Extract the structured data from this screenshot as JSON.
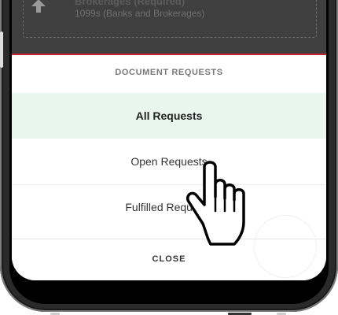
{
  "background_card": {
    "title": "Brokerages (Required)",
    "subtitle": "1099s (Banks and Brokerages)",
    "icon": "upload-icon"
  },
  "sheet": {
    "header": "DOCUMENT REQUESTS",
    "options": [
      {
        "label": "All Requests",
        "selected": true
      },
      {
        "label": "Open Requests",
        "selected": false
      },
      {
        "label": "Fulfilled Requests",
        "selected": false
      }
    ],
    "close_label": "CLOSE",
    "accent_color": "#c9242f",
    "selected_color": "#e9f5ef"
  },
  "overlay": {
    "pointer_icon": "hand-pointer-icon"
  }
}
